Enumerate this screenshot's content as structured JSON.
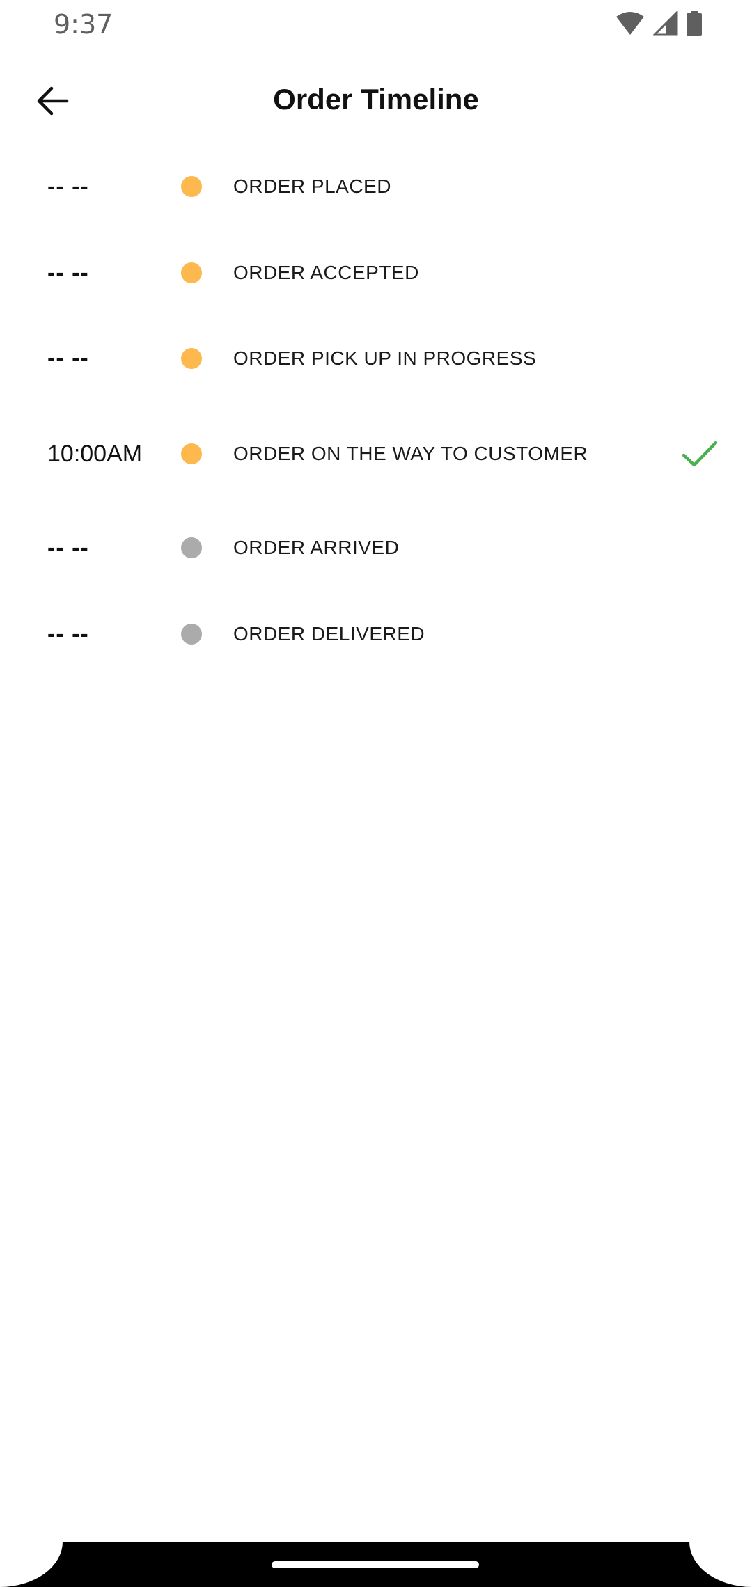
{
  "status_bar": {
    "time": "9:37",
    "icons": [
      "wifi-icon",
      "cellular-signal-icon",
      "battery-icon"
    ]
  },
  "app_bar": {
    "back_icon": "arrow-left-icon",
    "title": "Order Timeline"
  },
  "colors": {
    "completed_dot": "#FDB94E",
    "pending_dot": "#ABABAB",
    "check": "#4CAF50"
  },
  "timeline": [
    {
      "time": "-- --",
      "label": "ORDER PLACED",
      "state": "completed",
      "current": false
    },
    {
      "time": "-- --",
      "label": "ORDER ACCEPTED",
      "state": "completed",
      "current": false
    },
    {
      "time": "-- --",
      "label": "ORDER PICK UP IN PROGRESS",
      "state": "completed",
      "current": false
    },
    {
      "time": "10:00AM",
      "label": "ORDER ON THE WAY TO CUSTOMER",
      "state": "completed",
      "current": true
    },
    {
      "time": "-- --",
      "label": "ORDER ARRIVED",
      "state": "pending",
      "current": false
    },
    {
      "time": "-- --",
      "label": "ORDER DELIVERED",
      "state": "pending",
      "current": false
    }
  ]
}
